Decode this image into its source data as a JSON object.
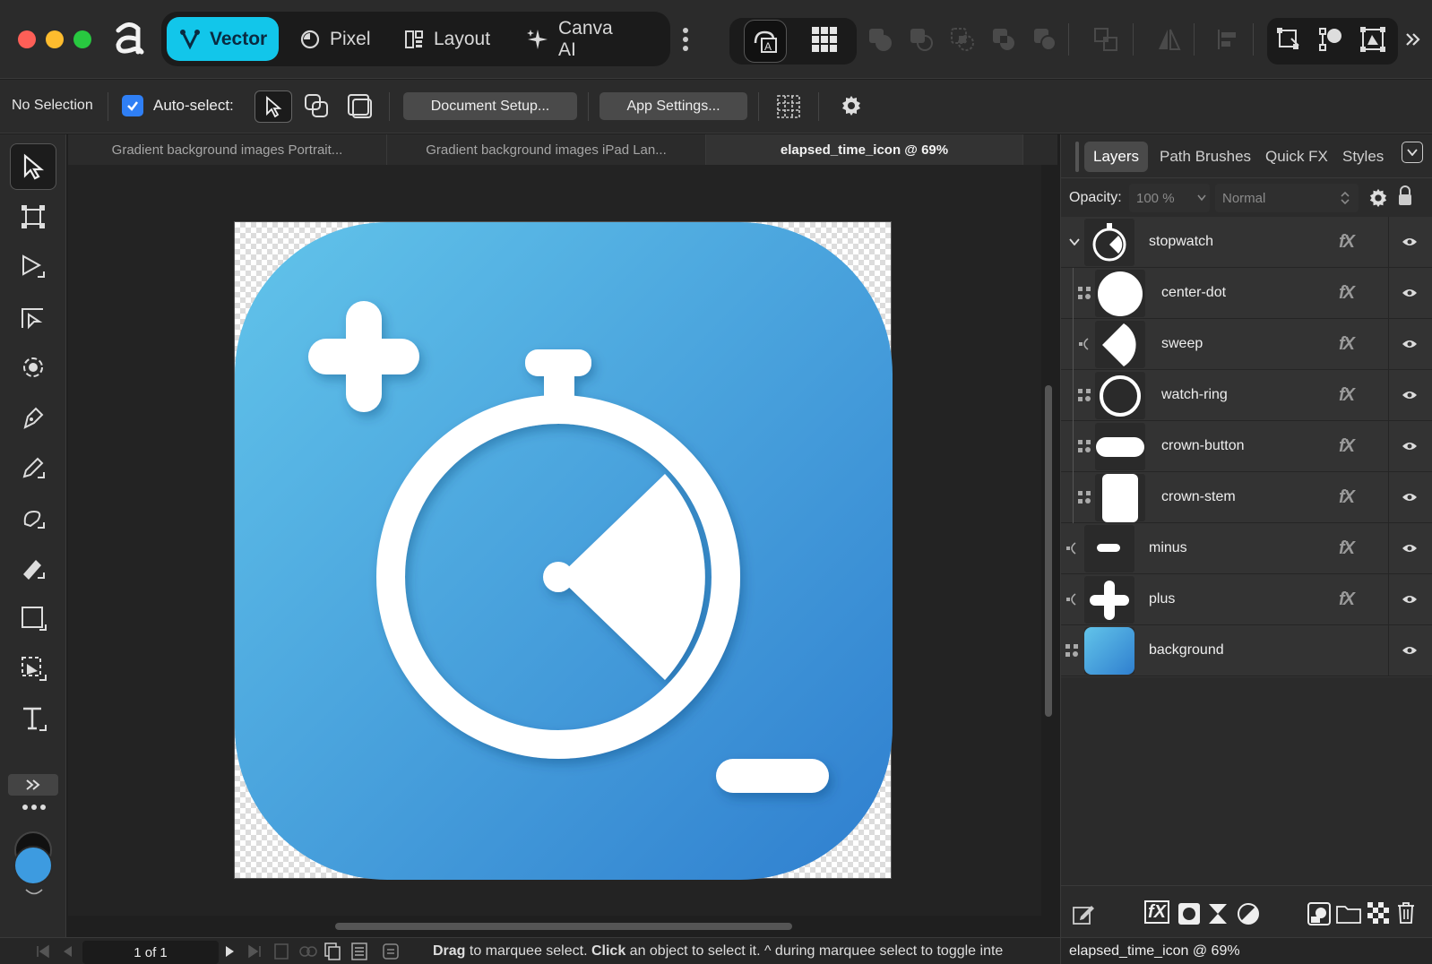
{
  "titlebar": {
    "personas": [
      {
        "label": "Vector",
        "icon": "vector-persona-icon",
        "active": true
      },
      {
        "label": "Pixel",
        "icon": "pixel-persona-icon",
        "active": false
      },
      {
        "label": "Layout",
        "icon": "layout-persona-icon",
        "active": false
      },
      {
        "label": "Canva AI",
        "icon": "sparkle-icon",
        "active": false
      }
    ],
    "accent": "#12c6ea"
  },
  "context": {
    "selection": "No Selection",
    "auto_select_label": "Auto-select:",
    "auto_select_checked": true,
    "document_setup": "Document Setup...",
    "app_settings": "App Settings..."
  },
  "tabs": [
    {
      "label": "Gradient background images Portrait...",
      "active": false
    },
    {
      "label": "Gradient background images iPad Lan...",
      "active": false
    },
    {
      "label": "elapsed_time_icon @ 69%",
      "active": true
    }
  ],
  "panel": {
    "tabs": [
      "Layers",
      "Path Brushes",
      "Quick FX",
      "Styles"
    ],
    "active_tab": "Layers",
    "opacity_label": "Opacity:",
    "opacity_value": "100 %",
    "blend_mode": "Normal",
    "layers": [
      {
        "name": "stopwatch",
        "indent": 0,
        "expanded": true
      },
      {
        "name": "center-dot",
        "indent": 1
      },
      {
        "name": "sweep",
        "indent": 1
      },
      {
        "name": "watch-ring",
        "indent": 1
      },
      {
        "name": "crown-button",
        "indent": 1
      },
      {
        "name": "crown-stem",
        "indent": 1
      },
      {
        "name": "minus",
        "indent": 0
      },
      {
        "name": "plus",
        "indent": 0
      },
      {
        "name": "background",
        "indent": 0
      }
    ],
    "fx_label": "fX"
  },
  "bottom": {
    "page_indicator": "1 of 1",
    "hint_drag": "Drag",
    "hint_1": " to marquee select. ",
    "hint_click": "Click",
    "hint_2": " an object to select it. ^ during marquee select to toggle inte",
    "status": "elapsed_time_icon @ 69%"
  },
  "colors": {
    "icon_gradient_start": "#62c4ea",
    "icon_gradient_end": "#2f7fcf",
    "fill_color": "#3d9be0"
  }
}
